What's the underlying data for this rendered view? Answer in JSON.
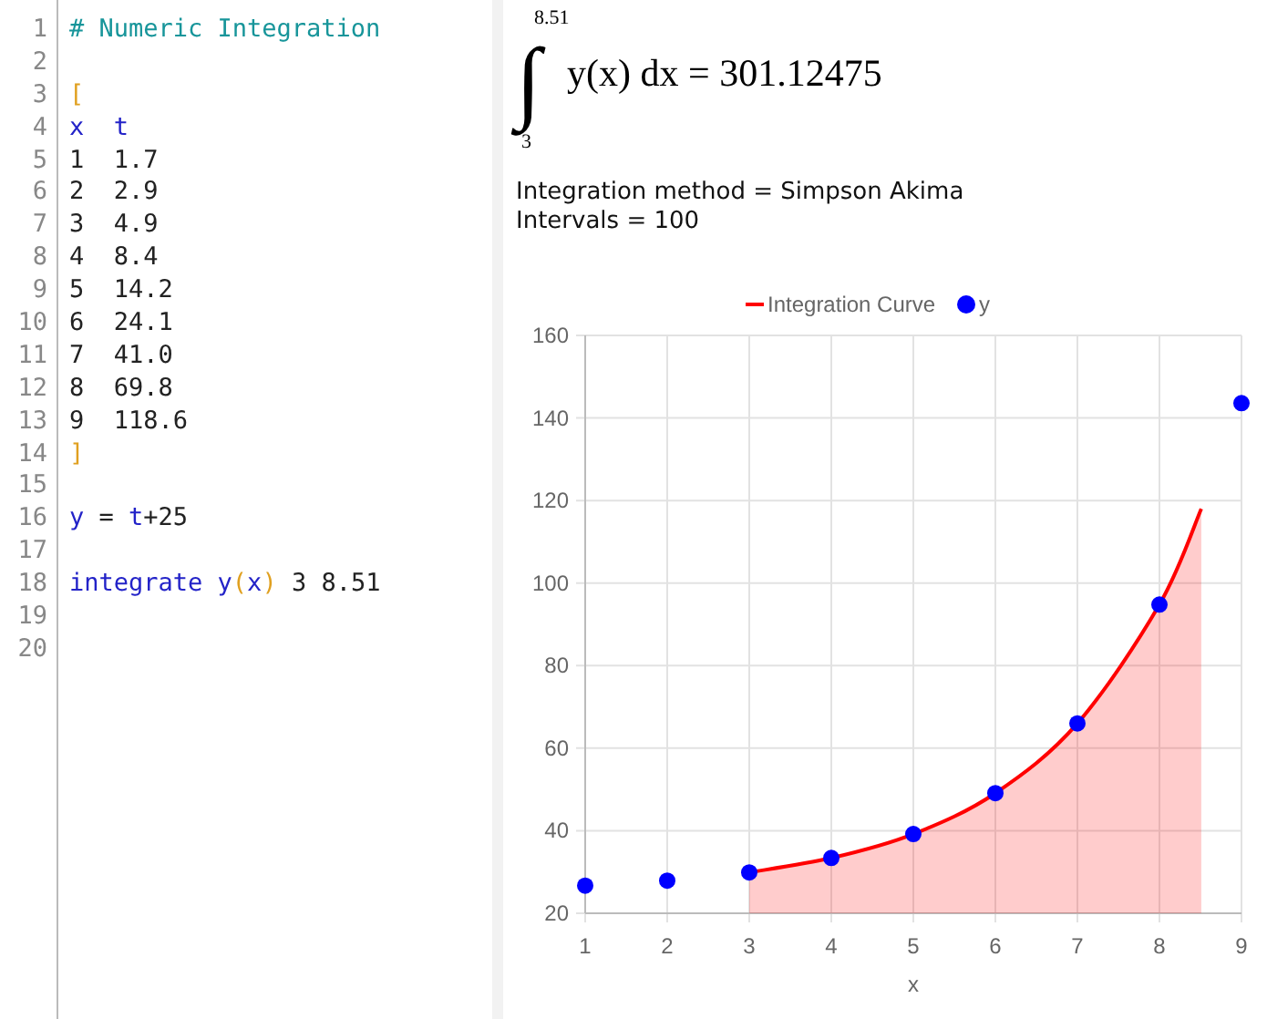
{
  "editor": {
    "lines": [
      {
        "number": "1",
        "tokens": [
          {
            "text": "# Numeric Integration",
            "kind": "comment"
          }
        ]
      },
      {
        "number": "2"
      },
      {
        "number": "3",
        "tokens": [
          {
            "text": "[",
            "kind": "bracket"
          }
        ]
      },
      {
        "number": "4",
        "tokens": [
          {
            "text": "x",
            "kind": "name"
          },
          {
            "text": "  t",
            "kind": "name"
          }
        ]
      },
      {
        "number": "5",
        "tokens": [
          {
            "text": "1  1.7",
            "kind": "plain"
          }
        ]
      },
      {
        "number": "6",
        "tokens": [
          {
            "text": "2  2.9",
            "kind": "plain"
          }
        ]
      },
      {
        "number": "7",
        "tokens": [
          {
            "text": "3  4.9",
            "kind": "plain"
          }
        ]
      },
      {
        "number": "8",
        "tokens": [
          {
            "text": "4  8.4",
            "kind": "plain"
          }
        ]
      },
      {
        "number": "9",
        "tokens": [
          {
            "text": "5  14.2",
            "kind": "plain"
          }
        ]
      },
      {
        "number": "10",
        "tokens": [
          {
            "text": "6  24.1",
            "kind": "plain"
          }
        ]
      },
      {
        "number": "11",
        "tokens": [
          {
            "text": "7  41.0",
            "kind": "plain"
          }
        ]
      },
      {
        "number": "12",
        "tokens": [
          {
            "text": "8  69.8",
            "kind": "plain"
          }
        ]
      },
      {
        "number": "13",
        "tokens": [
          {
            "text": "9  118.6",
            "kind": "plain"
          }
        ]
      },
      {
        "number": "14",
        "tokens": [
          {
            "text": "]",
            "kind": "bracket"
          }
        ]
      },
      {
        "number": "15"
      },
      {
        "number": "16",
        "tokens": [
          {
            "text": "y",
            "kind": "name"
          },
          {
            "text": " = ",
            "kind": "plain"
          },
          {
            "text": "t",
            "kind": "name"
          },
          {
            "text": "+25",
            "kind": "plain"
          }
        ]
      },
      {
        "number": "17"
      },
      {
        "number": "18",
        "tokens": [
          {
            "text": "integrate y",
            "kind": "name"
          },
          {
            "text": "(",
            "kind": "bracket"
          },
          {
            "text": "x",
            "kind": "name"
          },
          {
            "text": ")",
            "kind": "bracket"
          },
          {
            "text": " 3 8.51",
            "kind": "plain"
          }
        ]
      },
      {
        "number": "19"
      },
      {
        "number": "20"
      }
    ]
  },
  "result": {
    "integral": {
      "symbol": "∫",
      "upper": "8.51",
      "lower": "3",
      "expression": "y(x) dx = 301.12475"
    },
    "details": [
      "Integration method = Simpson Akima",
      "Intervals = 100"
    ],
    "chart_data": {
      "type": "area",
      "grid": true,
      "legend": "top",
      "xlabel": "x",
      "x": [
        1,
        2,
        3,
        4,
        5,
        6,
        7,
        8,
        8.51,
        9
      ],
      "series": [
        {
          "name": "Integration Curve",
          "marker": false,
          "color": "#ff0000",
          "values": [
            null,
            null,
            29.9,
            33.4,
            39.2,
            49.1,
            66.0,
            94.8,
            118.0,
            null
          ]
        },
        {
          "name": "y",
          "type": "scatter",
          "color": "#0000ff",
          "values": [
            26.7,
            27.9,
            29.9,
            33.4,
            39.2,
            49.1,
            66.0,
            94.8,
            null,
            143.6
          ]
        }
      ],
      "xlim": [
        1,
        9
      ],
      "ylim": [
        20,
        160
      ],
      "xticks": [
        1,
        2,
        3,
        4,
        5,
        6,
        7,
        8,
        9
      ],
      "yticks": [
        20,
        40,
        60,
        80,
        100,
        120,
        140,
        160
      ]
    }
  }
}
